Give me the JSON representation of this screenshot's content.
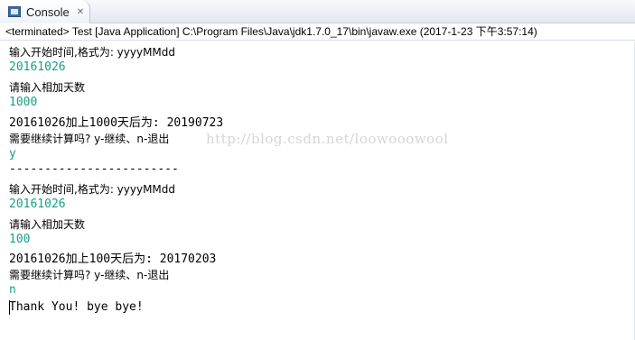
{
  "tab": {
    "title": "Console",
    "close": "✕"
  },
  "status": "<terminated> Test [Java Application] C:\\Program Files\\Java\\jdk1.7.0_17\\bin\\javaw.exe (2017-1-23 下午3:57:14)",
  "watermark": "http://blog.csdn.net/loowooowool",
  "lines": [
    "输入开始时间,格式为: yyyyMMdd",
    "20161026",
    "请输入相加天数",
    "1000",
    "20161026加上1000天后为: 20190723",
    "需要继续计算吗? y-继续、n-退出",
    "y",
    "------------------------",
    "输入开始时间,格式为: yyyyMMdd",
    "20161026",
    "请输入相加天数",
    "100",
    "20161026加上100天后为: 20170203",
    "需要继续计算吗? y-继续、n-退出",
    "n",
    "Thank You! bye bye!"
  ]
}
